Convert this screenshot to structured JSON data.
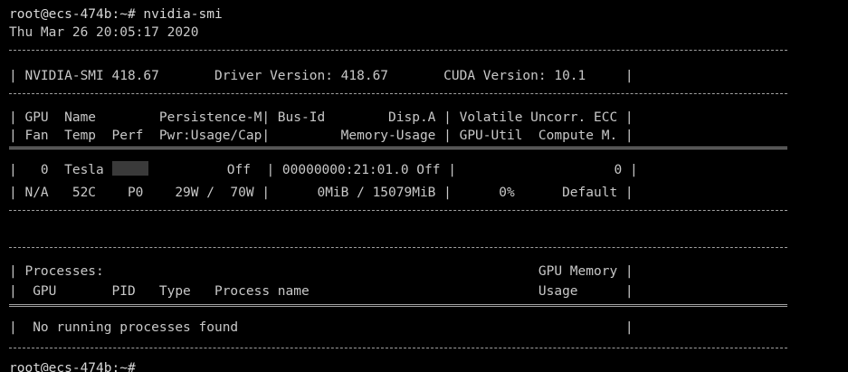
{
  "terminal": {
    "command_line": "root@ecs-474b:~# nvidia-smi",
    "timestamp": "Thu Mar 26 20:05:17 2020",
    "header_row": "| NVIDIA-SMI 418.67       Driver Version: 418.67       CUDA Version: 10.1     |",
    "gpu_table_header_row1": "| GPU  Name        Persistence-M| Bus-Id        Disp.A | Volatile Uncorr. ECC |",
    "gpu_table_header_row2": "| Fan  Temp  Perf  Pwr:Usage/Cap|         Memory-Usage | GPU-Util  Compute M. |",
    "gpu_row1_prefix": "|   0  Tesla ",
    "gpu_row1_suffix": "          Off  | 00000000:21:01.0 Off |                    0 |",
    "gpu_row2": "| N/A   52C    P0    29W /  70W |      0MiB / 15079MiB |      0%      Default |",
    "processes_header_row1": "| Processes:                                                       GPU Memory |",
    "processes_header_row2": "|  GPU       PID   Type   Process name                             Usage      |",
    "processes_row": "|  No running processes found                                                 |",
    "final_prompt": "root@ecs-474b:~#"
  }
}
